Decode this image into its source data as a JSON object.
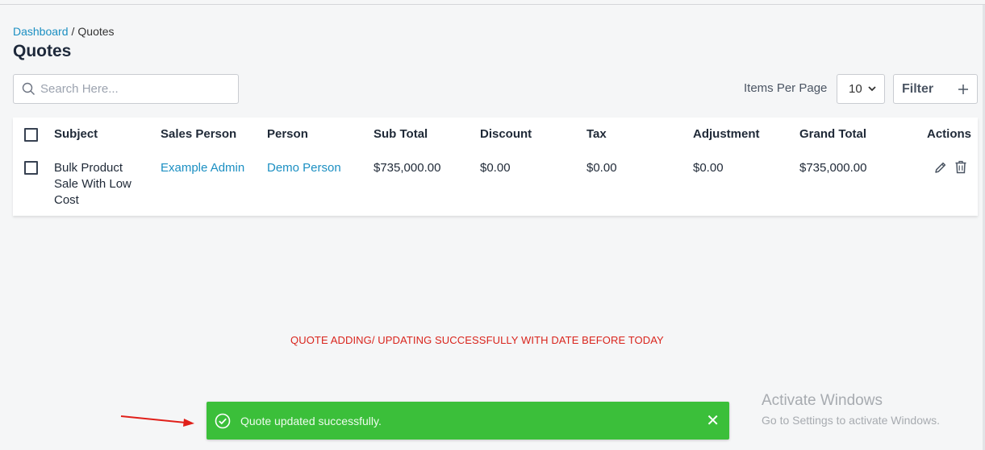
{
  "breadcrumb": {
    "home": "Dashboard",
    "separator": "/",
    "current": "Quotes"
  },
  "page": {
    "title": "Quotes"
  },
  "search": {
    "placeholder": "Search Here...",
    "value": ""
  },
  "pagination": {
    "items_per_page_label": "Items Per Page",
    "items_per_page_value": "10"
  },
  "filter": {
    "label": "Filter",
    "add_icon": "plus-icon"
  },
  "table": {
    "columns": [
      "Subject",
      "Sales Person",
      "Person",
      "Sub Total",
      "Discount",
      "Tax",
      "Adjustment",
      "Grand Total",
      "Actions"
    ],
    "rows": [
      {
        "subject": [
          "Bulk Product",
          "Sale With Low",
          "Cost"
        ],
        "sales_person": "Example Admin",
        "person": "Demo Person",
        "sub_total": "$735,000.00",
        "discount": "$0.00",
        "tax": "$0.00",
        "adjustment": "$0.00",
        "grand_total": "$735,000.00"
      }
    ]
  },
  "annotation": "QUOTE ADDING/ UPDATING SUCCESSFULLY WITH DATE BEFORE TODAY",
  "toast": {
    "message": "Quote updated successfully.",
    "close": "✕",
    "color": "#3bbf3a"
  },
  "watermark": {
    "title": "Activate Windows",
    "subtitle": "Go to Settings to activate Windows."
  },
  "colors": {
    "link": "#1b8fc2",
    "annotation": "#d9241c",
    "arrow": "#e0201a"
  }
}
